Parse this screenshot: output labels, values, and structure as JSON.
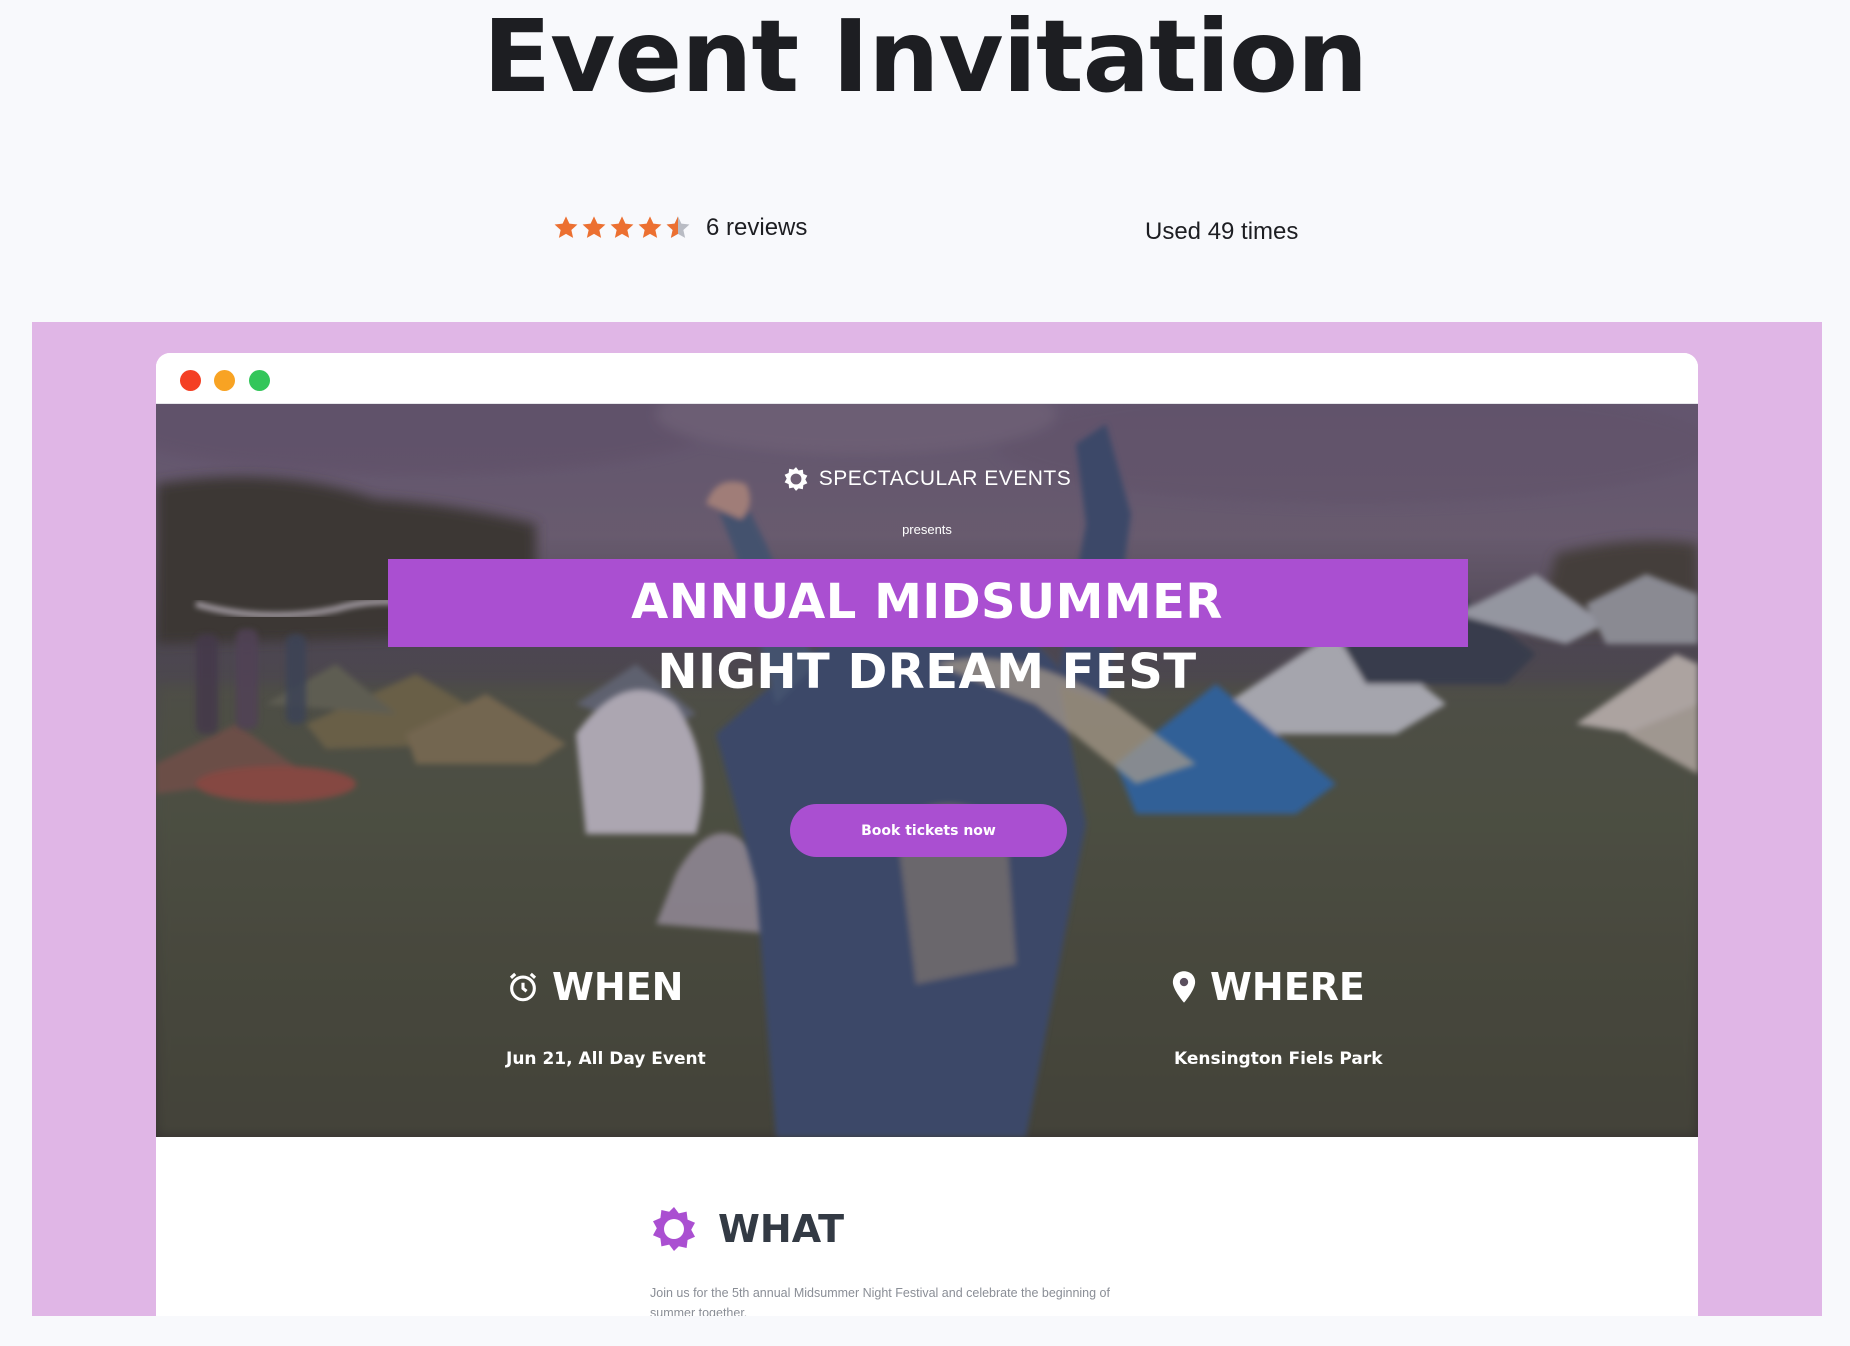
{
  "page": {
    "title": "Event Invitation",
    "rating": 4.5,
    "reviews_label": "6 reviews",
    "used_label": "Used 49 times",
    "star_color": "#ec7031"
  },
  "preview": {
    "background_color": "#e0b6e6",
    "window_dots": [
      "red",
      "yellow",
      "green"
    ],
    "hero": {
      "brand_icon": "sun-badge-icon",
      "brand": "SPECTACULAR EVENTS",
      "presents": "presents",
      "title_line1": "ANNUAL MIDSUMMER",
      "title_line2": "NIGHT DREAM FEST",
      "accent_color": "#aa4fd1",
      "cta_label": "Book tickets now",
      "when": {
        "icon": "alarm-clock-icon",
        "heading": "WHEN",
        "value": "Jun 21, All Day Event"
      },
      "where": {
        "icon": "map-pin-icon",
        "heading": "WHERE",
        "value": "Kensington Fiels Park"
      }
    },
    "what": {
      "icon": "sun-badge-icon",
      "heading": "WHAT",
      "body_line1": "Join us for the 5th annual Midsummer Night Festival and celebrate the beginning of",
      "body_line2": "summer together."
    }
  }
}
